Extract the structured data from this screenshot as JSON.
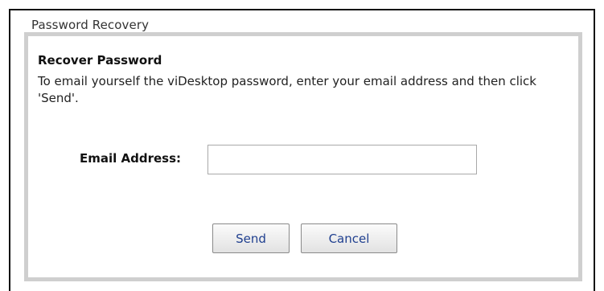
{
  "dialog": {
    "title": "Password Recovery"
  },
  "panel": {
    "heading": "Recover Password",
    "instructions": "To email yourself the viDesktop password, enter your email address and then click 'Send'."
  },
  "form": {
    "email_label": "Email Address:",
    "email_value": "",
    "email_placeholder": ""
  },
  "buttons": {
    "send_label": "Send",
    "cancel_label": "Cancel"
  }
}
